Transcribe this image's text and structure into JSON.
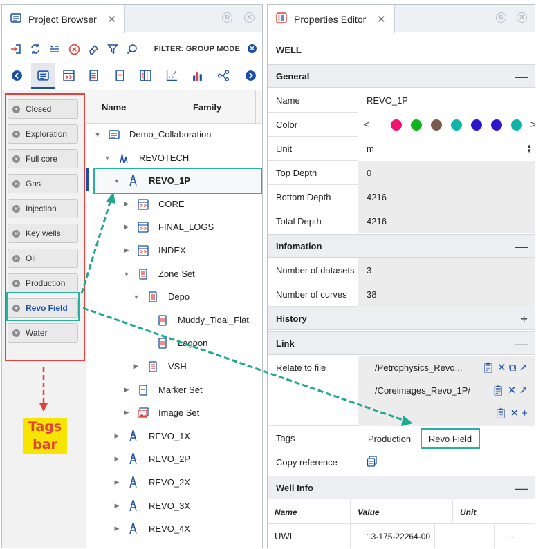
{
  "project_browser": {
    "tab_title": "Project Browser",
    "filter_label": "FILTER: GROUP MODE",
    "tags": [
      "Closed",
      "Exploration",
      "Full core",
      "Gas",
      "Injection",
      "Key wells",
      "Oil",
      "Production",
      "Revo Field",
      "Water"
    ],
    "active_tag": "Revo Field",
    "annotation": [
      "Tags",
      "bar"
    ],
    "columns": {
      "name": "Name",
      "family": "Family"
    },
    "tree": [
      {
        "label": "Demo_Collaboration",
        "level": 0,
        "caret": "down",
        "icon": "project-icon"
      },
      {
        "label": "REVOTECH",
        "level": 1,
        "caret": "down",
        "icon": "rig-group-icon"
      },
      {
        "label": "REVO_1P",
        "level": 2,
        "caret": "down",
        "icon": "well-icon",
        "selected": true
      },
      {
        "label": "CORE",
        "level": 3,
        "caret": "right",
        "icon": "dataset-icon"
      },
      {
        "label": "FINAL_LOGS",
        "level": 3,
        "caret": "right",
        "icon": "dataset-icon"
      },
      {
        "label": "INDEX",
        "level": 3,
        "caret": "right",
        "icon": "dataset-icon"
      },
      {
        "label": "Zone Set",
        "level": 3,
        "caret": "down",
        "icon": "zone-set-icon"
      },
      {
        "label": "Depo",
        "level": 4,
        "caret": "down",
        "icon": "zone-set-icon"
      },
      {
        "label": "Muddy_Tidal_Flat",
        "level": 5,
        "caret": "none",
        "icon": "zone-icon"
      },
      {
        "label": "Lagoon",
        "level": 5,
        "caret": "none",
        "icon": "zone-icon"
      },
      {
        "label": "VSH",
        "level": 4,
        "caret": "right",
        "icon": "zone-set-icon"
      },
      {
        "label": "Marker Set",
        "level": 3,
        "caret": "right",
        "icon": "marker-set-icon"
      },
      {
        "label": "Image Set",
        "level": 3,
        "caret": "right",
        "icon": "image-set-icon"
      },
      {
        "label": "REVO_1X",
        "level": 2,
        "caret": "right",
        "icon": "well-icon"
      },
      {
        "label": "REVO_2P",
        "level": 2,
        "caret": "right",
        "icon": "well-icon"
      },
      {
        "label": "REVO_2X",
        "level": 2,
        "caret": "right",
        "icon": "well-icon"
      },
      {
        "label": "REVO_3X",
        "level": 2,
        "caret": "right",
        "icon": "well-icon"
      },
      {
        "label": "REVO_4X",
        "level": 2,
        "caret": "right",
        "icon": "well-icon"
      }
    ]
  },
  "properties_editor": {
    "tab_title": "Properties Editor",
    "object_type": "WELL",
    "sections": {
      "general": "General",
      "information": "Infomation",
      "history": "History",
      "link": "Link",
      "well_info": "Well Info"
    },
    "general": {
      "name_label": "Name",
      "name_value": "REVO_1P",
      "color_label": "Color",
      "colors": [
        "#f0146e",
        "#12b21e",
        "#7a5a4a",
        "#11b3a8",
        "#2d18c9",
        "#2d18c9",
        "#11b3a8"
      ],
      "unit_label": "Unit",
      "unit_value": "m",
      "top_depth_label": "Top Depth",
      "top_depth_value": "0",
      "bottom_depth_label": "Bottom Depth",
      "bottom_depth_value": "4216",
      "total_depth_label": "Total Depth",
      "total_depth_value": "4216"
    },
    "information": {
      "datasets_label": "Number of datasets",
      "datasets_value": "3",
      "curves_label": "Number of curves",
      "curves_value": "38"
    },
    "link": {
      "relate_label": "Relate to file",
      "files": [
        "/Petrophysics_Revo...",
        "/Coreimages_Revo_1P/"
      ],
      "tags_label": "Tags",
      "tags": [
        "Production",
        "Revo Field"
      ],
      "copy_label": "Copy reference"
    },
    "well_info": {
      "columns": [
        "Name",
        "Value",
        "Unit"
      ],
      "rows": [
        {
          "name": "UWI",
          "value": "13-175-22264-00",
          "unit": "",
          "more": "···"
        }
      ]
    }
  },
  "accent_colors": {
    "primary": "#1a4fa3",
    "highlight": "#27b1a0",
    "annotation": "#e3413b"
  }
}
